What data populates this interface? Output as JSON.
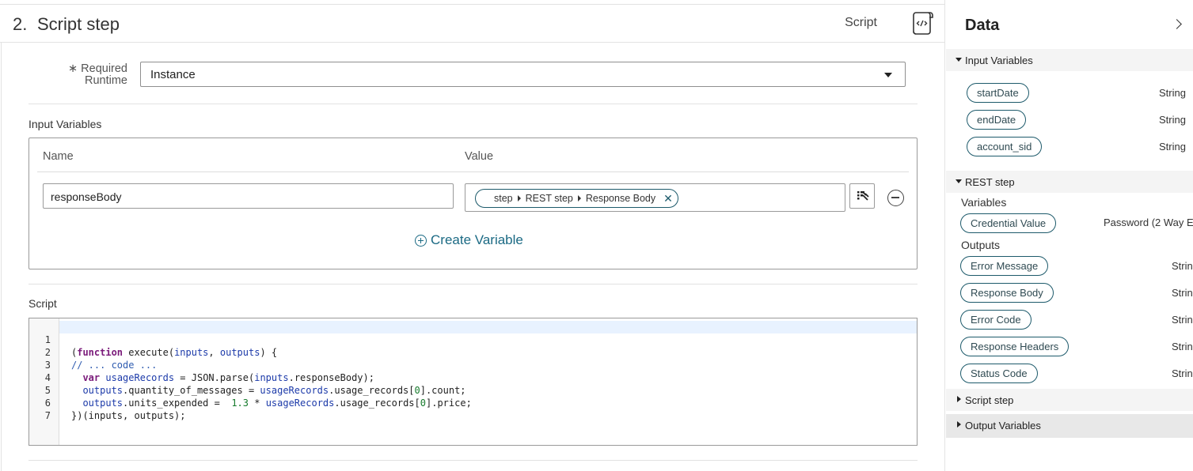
{
  "step": {
    "number": "2.",
    "title": "Script step",
    "type_label": "Script"
  },
  "runtime": {
    "label": "Required Runtime",
    "required_mark": "∗",
    "value": "Instance"
  },
  "input_variables": {
    "section_label": "Input Variables",
    "col_name": "Name",
    "col_value": "Value",
    "rows": [
      {
        "name": "responseBody",
        "value_path": [
          "step",
          "REST step",
          "Response Body"
        ]
      }
    ],
    "create_label": "Create Variable"
  },
  "script": {
    "section_label": "Script",
    "line_numbers": [
      "1",
      "2",
      "3",
      "4",
      "5",
      "6",
      "7"
    ]
  },
  "data_panel": {
    "title": "Data",
    "groups": [
      {
        "label": "Input Variables",
        "expanded": true,
        "items": [
          {
            "label": "startDate",
            "type": "String"
          },
          {
            "label": "endDate",
            "type": "String"
          },
          {
            "label": "account_sid",
            "type": "String"
          }
        ]
      },
      {
        "label": "REST step",
        "expanded": true,
        "variables_label": "Variables",
        "variables": [
          {
            "label": "Credential Value",
            "type": "Password (2 Way E"
          }
        ],
        "outputs_label": "Outputs",
        "outputs": [
          {
            "label": "Error Message",
            "type": "Strin"
          },
          {
            "label": "Response Body",
            "type": "Strin"
          },
          {
            "label": "Error Code",
            "type": "Strin"
          },
          {
            "label": "Response Headers",
            "type": "Strin"
          },
          {
            "label": "Status Code",
            "type": "Strin"
          }
        ]
      },
      {
        "label": "Script step",
        "expanded": false
      },
      {
        "label": "Output Variables",
        "expanded": false
      }
    ]
  }
}
